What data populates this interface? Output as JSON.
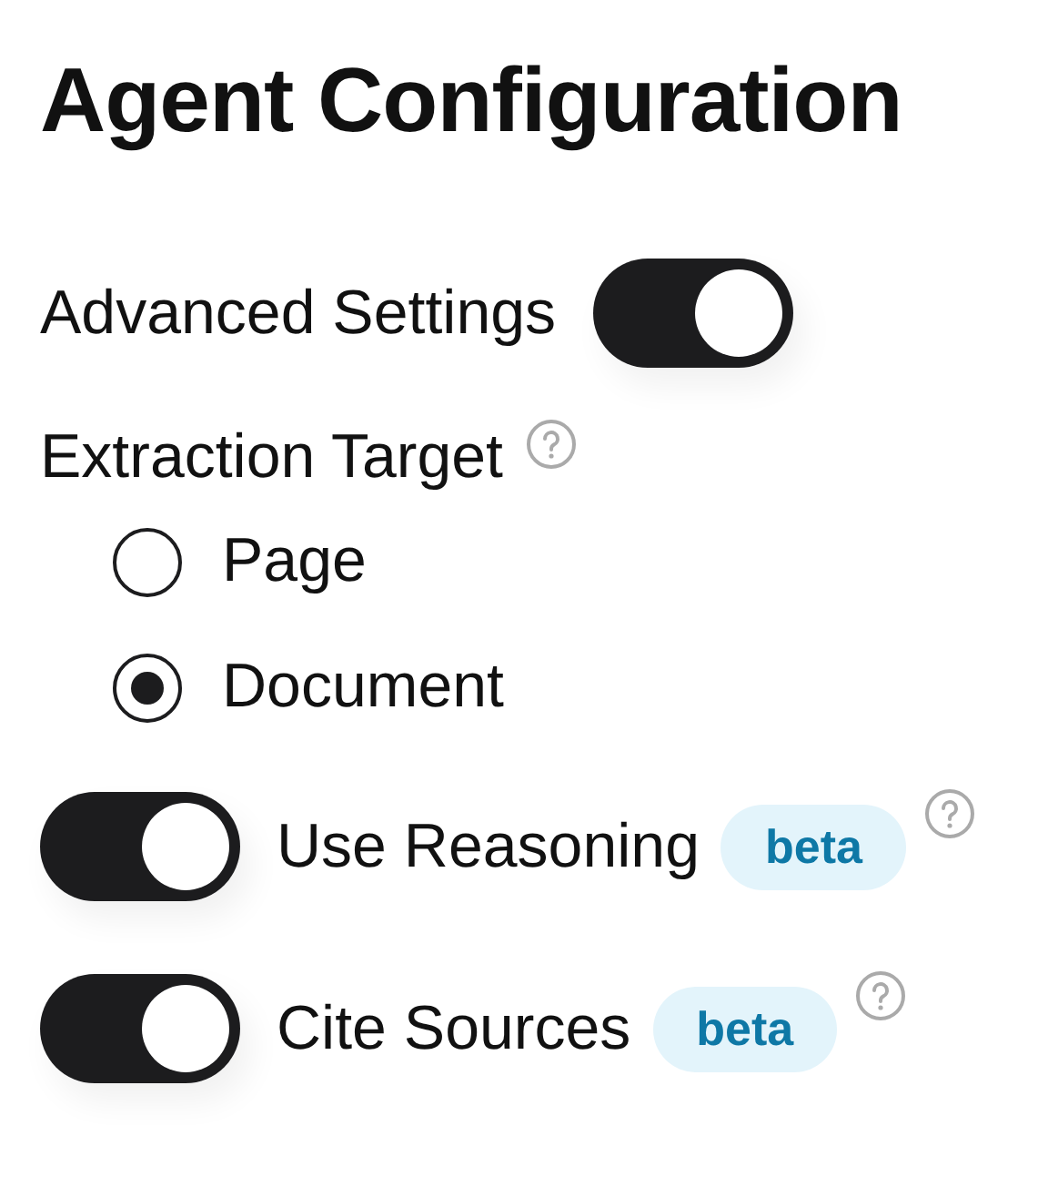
{
  "title": "Agent Configuration",
  "advanced": {
    "label": "Advanced Settings",
    "on": true
  },
  "extraction": {
    "label": "Extraction Target",
    "help": true,
    "options": [
      {
        "label": "Page",
        "selected": false
      },
      {
        "label": "Document",
        "selected": true
      }
    ]
  },
  "features": [
    {
      "label": "Use Reasoning",
      "on": true,
      "badge": "beta",
      "help": true
    },
    {
      "label": "Cite Sources",
      "on": true,
      "badge": "beta",
      "help": true
    }
  ]
}
